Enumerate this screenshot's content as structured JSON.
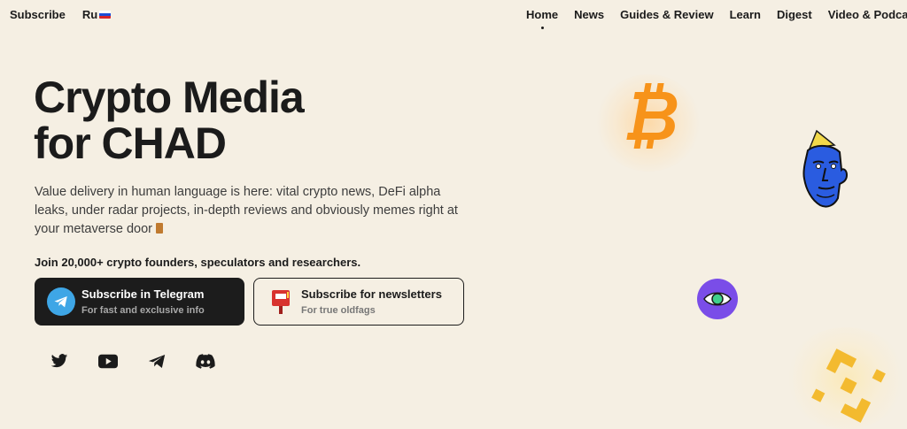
{
  "nav": {
    "left": {
      "subscribe": "Subscribe",
      "lang": "Ru"
    },
    "right": [
      "Home",
      "News",
      "Guides & Review",
      "Learn",
      "Digest",
      "Video & Podcasts"
    ]
  },
  "hero": {
    "title_line1": "Crypto Media",
    "title_line2": "for CHAD",
    "description": "Value delivery in human language is here: vital crypto news, DeFi alpha leaks, under radar projects, in-depth reviews and obviously memes right at your metaverse door",
    "join": "Join 20,000+ crypto founders, speculators and researchers."
  },
  "cta": {
    "telegram": {
      "title": "Subscribe in Telegram",
      "subtitle": "For fast and exclusive info",
      "icon": "telegram-icon"
    },
    "newsletter": {
      "title": "Subscribe for newsletters",
      "subtitle": "For true oldfags",
      "icon": "mailbox-icon"
    }
  },
  "socials": [
    "twitter-icon",
    "youtube-icon",
    "telegram-icon",
    "discord-icon"
  ],
  "colors": {
    "background": "#f5efe3",
    "bitcoin": "#f7931a",
    "binance": "#f3ba2f",
    "eye_purple": "#7a4de8",
    "telegram_blue": "#3ea6e6"
  }
}
